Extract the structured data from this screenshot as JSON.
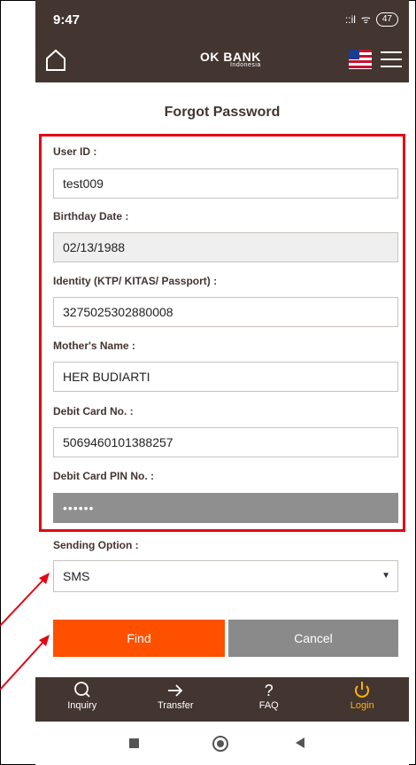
{
  "status": {
    "time": "9:47",
    "signal": "::il",
    "wifi": "ᯤ",
    "battery": "47"
  },
  "header": {
    "logo_main": "OK BANK",
    "logo_sub": "Indonesia"
  },
  "form": {
    "title": "Forgot Password",
    "user_id_label": "User ID :",
    "user_id_value": "test009",
    "birthday_label": "Birthday Date :",
    "birthday_value": "02/13/1988",
    "identity_label": "Identity (KTP/ KITAS/ Passport) :",
    "identity_value": "3275025302880008",
    "mother_label": "Mother's Name :",
    "mother_value": "HER BUDIARTI",
    "debit_label": "Debit Card No. :",
    "debit_value": "5069460101388257",
    "pin_label": "Debit Card PIN No. :",
    "pin_value": "••••••",
    "sending_label": "Sending Option :",
    "sending_value": "SMS"
  },
  "buttons": {
    "find": "Find",
    "cancel": "Cancel"
  },
  "tabs": [
    {
      "label": "Inquiry",
      "icon": "search-icon"
    },
    {
      "label": "Transfer",
      "icon": "transfer-icon"
    },
    {
      "label": "FAQ",
      "icon": "question-icon"
    },
    {
      "label": "Login",
      "icon": "power-icon"
    }
  ],
  "colors": {
    "header": "#433530",
    "accent": "#ff5000",
    "highlight": "#e30613",
    "active_tab": "#ffb300"
  }
}
